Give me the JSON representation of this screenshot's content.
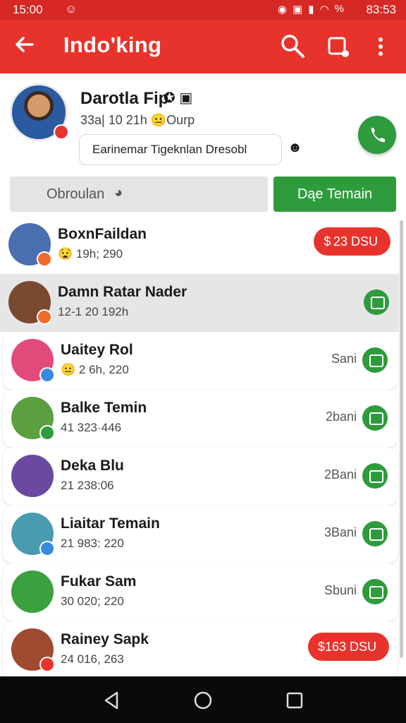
{
  "status_bar": {
    "time": "15:00",
    "battery_pct": "%",
    "clock": "83:53"
  },
  "app_bar": {
    "title": "Indo'king"
  },
  "profile": {
    "name": "Darotla Fip",
    "meta": "33a| 10 21h 😐Ourp",
    "status": "Earinemar Tigeknlan Dresobl"
  },
  "tabs": {
    "left": "Obroulan",
    "right": "Dąe Temain"
  },
  "contacts": [
    {
      "name": "BoxnFaildan",
      "sub": "😧 19h; 290",
      "right_pill": "$ 23 DSU",
      "avatar_color": "#4a6fb0",
      "badge_color": "#f06a2a"
    },
    {
      "name": "Damn Ratar Nader",
      "sub": "12-1 20 192h",
      "right_text": "",
      "avatar_color": "#7a4a30",
      "badge_color": "#f06a2a"
    },
    {
      "name": "Uaitey Rol",
      "sub": "😐 2 6h, 220",
      "right_text": "Sani",
      "avatar_color": "#e24a7a",
      "badge_color": "#3a8ae0"
    },
    {
      "name": "Balke Temin",
      "sub": "41 323·446",
      "right_text": "2bani",
      "avatar_color": "#5aa040",
      "badge_color": "#2e9b3c"
    },
    {
      "name": "Deka Blu",
      "sub": "21 238:06",
      "right_text": "2Bani",
      "avatar_color": "#6a4aa0",
      "badge_color": ""
    },
    {
      "name": "Liaitar Temain",
      "sub": "21 983: 220",
      "right_text": "3Bani",
      "avatar_color": "#4a9ab0",
      "badge_color": "#3a8ae0"
    },
    {
      "name": "Fukar Sam",
      "sub": "30 020; 220",
      "right_text": "Sbuni",
      "avatar_color": "#3aa040",
      "badge_color": ""
    },
    {
      "name": "Rainey Sapk",
      "sub": "24 016, 263",
      "right_pill": "$163 DSU",
      "avatar_color": "#a04a30",
      "badge_color": "#e8332c"
    }
  ]
}
